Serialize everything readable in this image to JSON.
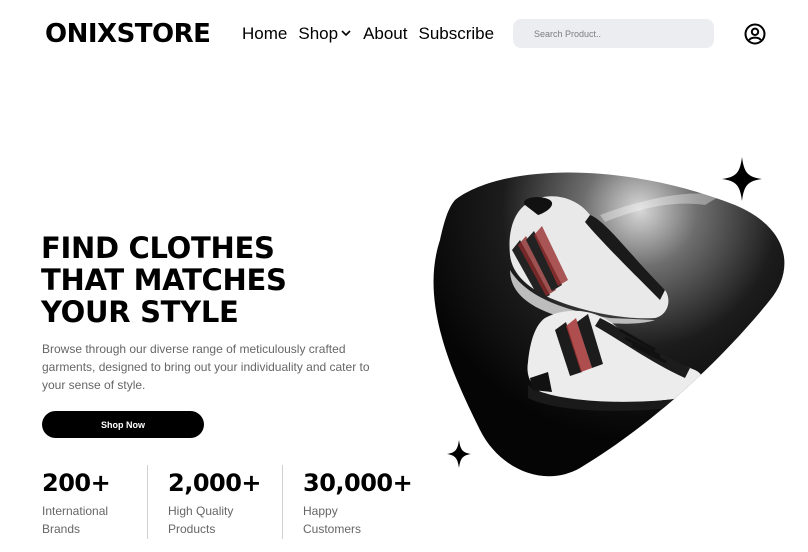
{
  "header": {
    "logo": "ONIXSTORE",
    "nav": [
      {
        "label": "Home"
      },
      {
        "label": "Shop",
        "has_dropdown": true
      },
      {
        "label": "About"
      },
      {
        "label": "Subscribe"
      }
    ],
    "search_placeholder": "Search Product..",
    "user_icon": "user-circle-icon"
  },
  "hero": {
    "headline_lines": [
      "FIND CLOTHES",
      "THAT MATCHES",
      "YOUR STYLE"
    ],
    "description": "Browse through our diverse range of meticulously crafted garments, designed to bring out your individuality and cater to your sense of style.",
    "cta_label": "Shop Now",
    "image_icon": "sneakers-image",
    "sparkle_icons": [
      "four-point-star-icon",
      "four-point-star-icon"
    ]
  },
  "stats": [
    {
      "value": "200+",
      "label_lines": [
        "International",
        "Brands"
      ]
    },
    {
      "value": "2,000+",
      "label_lines": [
        "High Quality",
        "Products"
      ]
    },
    {
      "value": "30,000+",
      "label_lines": [
        "Happy",
        "Customers"
      ]
    }
  ],
  "colors": {
    "primary": "#000000",
    "background": "#ffffff",
    "search_bg": "#ebedf0",
    "muted_text": "#666666"
  }
}
